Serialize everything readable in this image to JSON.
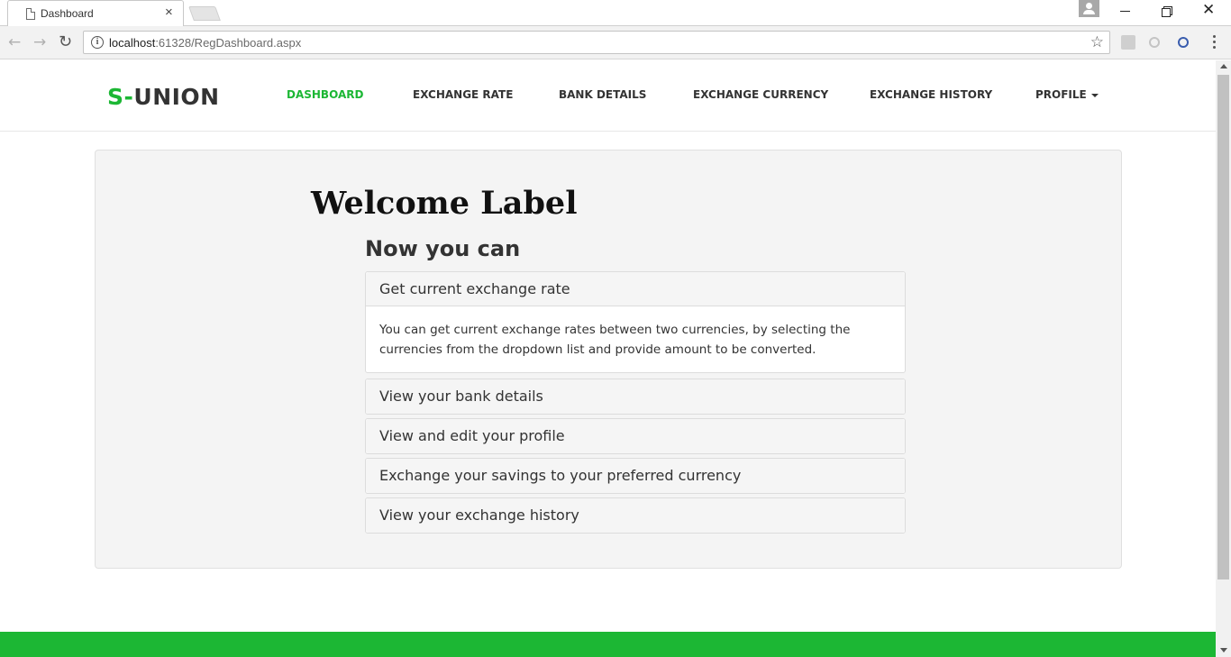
{
  "browser": {
    "tab_title": "Dashboard",
    "tab_close": "×",
    "url_host": "localhost",
    "url_path": ":61328/RegDashboard.aspx",
    "back_glyph": "←",
    "forward_glyph": "→",
    "reload_glyph": "↻",
    "info_glyph": "i",
    "star_glyph": "☆",
    "close_glyph": "✕"
  },
  "site": {
    "brand_accent": "S-",
    "brand_rest": "UNION",
    "brand_color": "#1cb734",
    "nav": {
      "dashboard": "DASHBOARD",
      "exchange_rate": "EXCHANGE RATE",
      "bank_details": "BANK DETAILS",
      "exchange_currency": "EXCHANGE CURRENCY",
      "exchange_history": "EXCHANGE HISTORY",
      "profile": "PROFILE"
    }
  },
  "main": {
    "welcome": "Welcome Label",
    "subheading": "Now you can",
    "panels": [
      {
        "title": "Get current exchange rate",
        "body": "You can get current exchange rates between two currencies, by selecting the currencies from the dropdown list and provide amount to be converted.",
        "expanded": true
      },
      {
        "title": "View your bank details",
        "expanded": false
      },
      {
        "title": "View and edit your profile",
        "expanded": false
      },
      {
        "title": "Exchange your savings to your preferred currency",
        "expanded": false
      },
      {
        "title": "View your exchange history",
        "expanded": false
      }
    ]
  }
}
